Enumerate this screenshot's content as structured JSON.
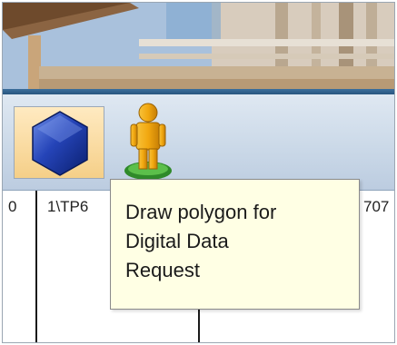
{
  "toolbar": {
    "polygon_tool": {
      "icon": "hexagon-icon",
      "selected": true
    },
    "person_tool": {
      "icon": "person-icon"
    }
  },
  "table": {
    "cells": [
      "0",
      "1\\TP6",
      "707"
    ]
  },
  "tooltip": {
    "lines": [
      "Draw polygon for",
      "Digital Data",
      "Request"
    ]
  },
  "colors": {
    "tooltip_bg": "#ffffe4",
    "selected_button": "#f5cf88",
    "toolbar": "#cbd9e8",
    "hexagon": "#1f3fa8"
  }
}
